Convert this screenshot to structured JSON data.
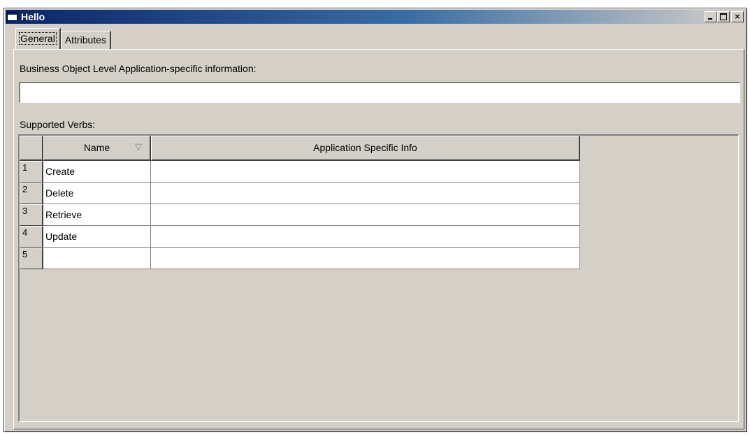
{
  "window": {
    "title": "Hello",
    "minimize_glyph": "_",
    "maximize_glyph": "□",
    "close_glyph": "×"
  },
  "tabs": [
    {
      "label": "General",
      "active": true
    },
    {
      "label": "Attributes",
      "active": false
    }
  ],
  "general": {
    "bo_info_label": "Business Object Level Application-specific information:",
    "bo_info_value": "",
    "verbs_label": "Supported Verbs:"
  },
  "grid": {
    "columns": [
      "Name",
      "Application Specific Info"
    ],
    "sort_glyph": "▽",
    "rows": [
      {
        "num": "1",
        "name": "Create",
        "info": ""
      },
      {
        "num": "2",
        "name": "Delete",
        "info": ""
      },
      {
        "num": "3",
        "name": "Retrieve",
        "info": ""
      },
      {
        "num": "4",
        "name": "Update",
        "info": ""
      },
      {
        "num": "5",
        "name": "",
        "info": ""
      }
    ]
  },
  "colors": {
    "title_active": "#0a246a",
    "face": "#d4d0c8"
  }
}
